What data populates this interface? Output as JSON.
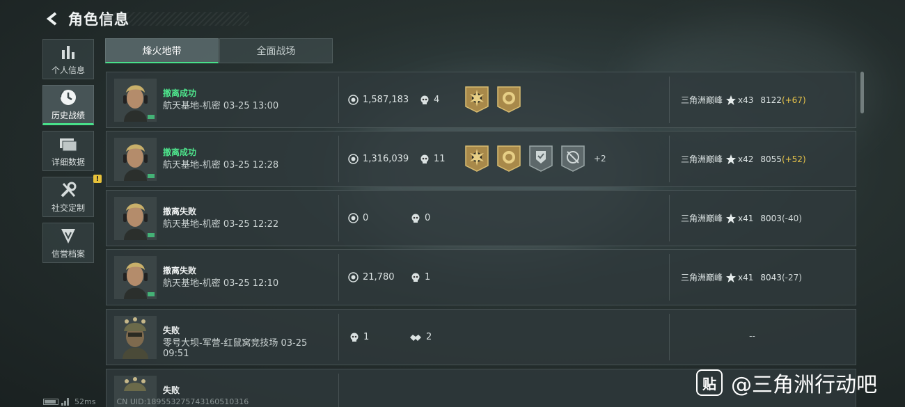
{
  "header": {
    "title": "角色信息"
  },
  "sidebar": {
    "items": [
      {
        "label": "个人信息",
        "icon": "bar-chart-icon",
        "active": false
      },
      {
        "label": "历史战绩",
        "icon": "history-icon",
        "active": true
      },
      {
        "label": "详细数据",
        "icon": "folders-icon",
        "active": false
      },
      {
        "label": "社交定制",
        "icon": "tools-icon",
        "active": false,
        "badge": "!"
      },
      {
        "label": "信誉档案",
        "icon": "shield-icon",
        "active": false
      }
    ]
  },
  "tabs": [
    {
      "label": "烽火地带",
      "active": true
    },
    {
      "label": "全面战场",
      "active": false
    }
  ],
  "records": [
    {
      "status": "撤离成功",
      "status_type": "success",
      "map": "航天基地-机密 03-25 13:00",
      "value": "1,587,183",
      "kills": "4",
      "badges": [
        "gold-sun-badge-icon",
        "gold-coin-badge-icon"
      ],
      "more": "",
      "rank_name": "三角洲巅峰",
      "stars": "x43",
      "score": "8122",
      "delta": "(+67)",
      "delta_type": "pos"
    },
    {
      "status": "撤离成功",
      "status_type": "success",
      "map": "航天基地-机密 03-25 12:28",
      "value": "1,316,039",
      "kills": "11",
      "badges": [
        "gold-sun-badge-icon",
        "gold-coin-badge-icon",
        "silver-shield-badge-icon",
        "silver-target-badge-icon"
      ],
      "more": "+2",
      "rank_name": "三角洲巅峰",
      "stars": "x42",
      "score": "8055",
      "delta": "(+52)",
      "delta_type": "pos"
    },
    {
      "status": "撤离失败",
      "status_type": "fail",
      "map": "航天基地-机密 03-25 12:22",
      "value": "0",
      "kills": "0",
      "badges": [],
      "more": "",
      "rank_name": "三角洲巅峰",
      "stars": "x41",
      "score": "8003",
      "delta": "(-40)",
      "delta_type": "neg"
    },
    {
      "status": "撤离失败",
      "status_type": "fail",
      "map": "航天基地-机密 03-25 12:10",
      "value": "21,780",
      "kills": "1",
      "badges": [],
      "more": "",
      "rank_name": "三角洲巅峰",
      "stars": "x41",
      "score": "8043",
      "delta": "(-27)",
      "delta_type": "neg"
    },
    {
      "status": "失败",
      "status_type": "fail",
      "map": "零号大坝-军营-红鼠窝竞技场 03-25 09:51",
      "kills": "1",
      "assists": "2",
      "dash": "--"
    },
    {
      "status": "失败",
      "status_type": "fail",
      "map": ""
    }
  ],
  "footer": {
    "ping": "52ms",
    "uid": "CN UID:189553275743160510316"
  },
  "watermark": {
    "logo": "贴",
    "text": "@三角洲行动吧"
  }
}
